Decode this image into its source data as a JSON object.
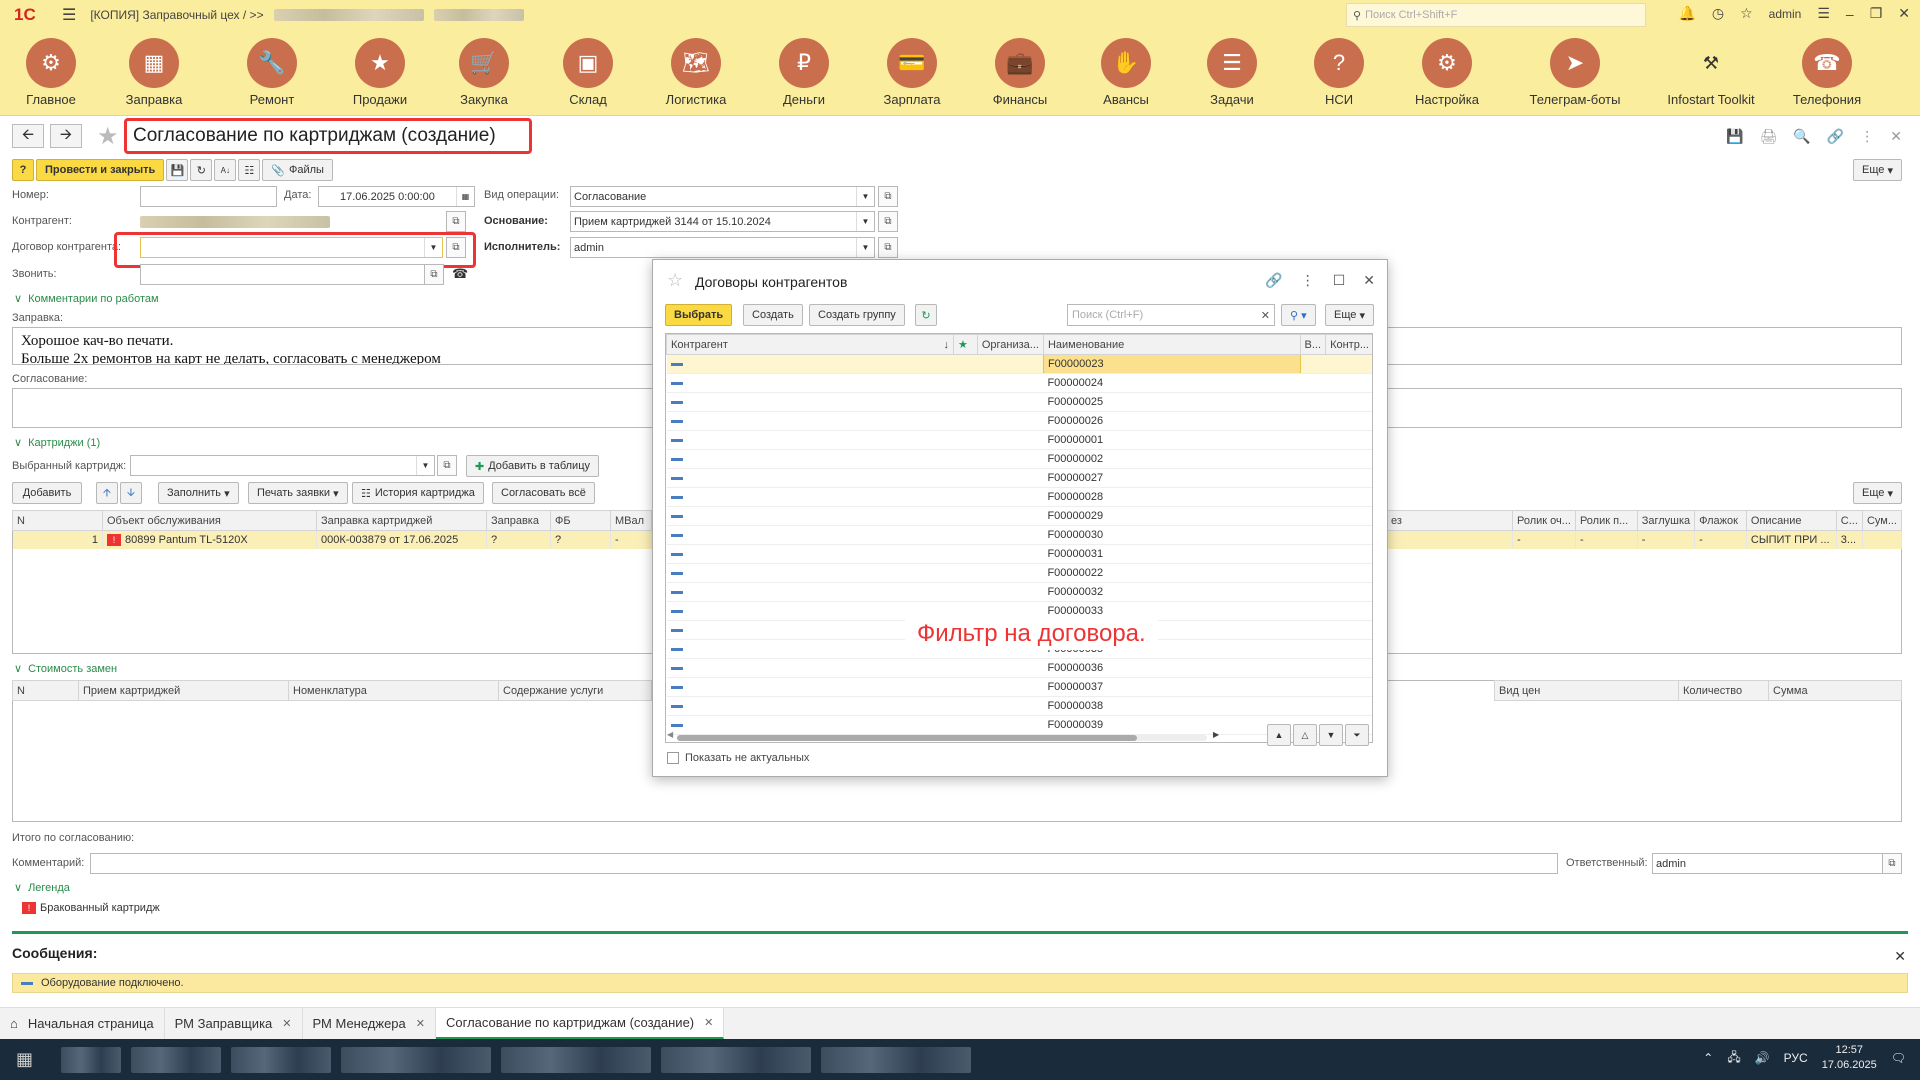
{
  "topbar": {
    "app_title": "[КОПИЯ] Заправочный цех / >>",
    "search_placeholder": "Поиск Ctrl+Shift+F",
    "user": "admin"
  },
  "sections": [
    {
      "label": "Главное",
      "icon": "gear-icon"
    },
    {
      "label": "Заправка",
      "icon": "cartridge-icon"
    },
    {
      "label": "Ремонт",
      "icon": "wrench-icon"
    },
    {
      "label": "Продажи",
      "icon": "sale-icon"
    },
    {
      "label": "Закупка",
      "icon": "cart-icon"
    },
    {
      "label": "Склад",
      "icon": "boxes-icon"
    },
    {
      "label": "Логистика",
      "icon": "map-icon"
    },
    {
      "label": "Деньги",
      "icon": "money-bag-icon"
    },
    {
      "label": "Зарплата",
      "icon": "wallet-icon"
    },
    {
      "label": "Финансы",
      "icon": "briefcase-icon"
    },
    {
      "label": "Авансы",
      "icon": "hand-money-icon"
    },
    {
      "label": "Задачи",
      "icon": "task-list-icon"
    },
    {
      "label": "НСИ",
      "icon": "question-doc-icon"
    },
    {
      "label": "Настройка",
      "icon": "settings-icon"
    },
    {
      "label": "Телеграм-боты",
      "icon": "telegram-icon"
    },
    {
      "label": "Infostart Toolkit",
      "icon": "tools-icon"
    },
    {
      "label": "Телефония",
      "icon": "phone-icon"
    }
  ],
  "document": {
    "title": "Согласование по картриджам (создание)",
    "post_close": "Провести и закрыть",
    "files": "Файлы",
    "more": "Еще",
    "labels": {
      "number": "Номер:",
      "date": "Дата:",
      "operation": "Вид операции:",
      "counterparty": "Контрагент:",
      "basis": "Основание:",
      "contract": "Договор контрагента:",
      "executor": "Исполнитель:",
      "call": "Звонить:"
    },
    "values": {
      "date": "17.06.2025  0:00:00",
      "operation": "Согласование",
      "basis": "Прием картриджей 3144 от 15.10.2024",
      "executor": "admin"
    },
    "comments_group": "Комментарии по работам",
    "refill_label": "Заправка:",
    "refill_text_1": "Хорошое кач-во печати.",
    "refill_text_2": "Больше 2х ремонтов на карт не делать, согласовать с менеджером",
    "approval_label": "Согласование:",
    "cartridges_group": "Картриджи (1)",
    "selected_cartridge": "Выбранный картридж:",
    "add_to_table": "Добавить в таблицу",
    "buttons": {
      "add": "Добавить",
      "fill": "Заполнить",
      "print": "Печать заявки",
      "history": "История картриджа",
      "approve_all": "Согласовать всё"
    },
    "cart_columns": [
      "N",
      "Объект обслуживания",
      "Заправка картриджей",
      "Заправка",
      "ФБ",
      "МВал"
    ],
    "cart_columns_right": [
      "Ролик оч...",
      "Ролик п...",
      "Заглушка",
      "Флажок",
      "Описание",
      "С...",
      "Сум..."
    ],
    "cart_columns_mid_tail": "ез",
    "cart_row": {
      "n": "1",
      "object": "80899 Pantum TL-5120X",
      "refill_doc": "000К-003879 от 17.06.2025",
      "refill": "?",
      "fb": "?",
      "mval": "-",
      "right": [
        "-",
        "-",
        "-",
        "-",
        "СЫПИТ ПРИ ...",
        "3..."
      ]
    },
    "cost_group": "Стоимость замен",
    "cost_columns": [
      "N",
      "Прием картриджей",
      "Номенклатура",
      "Содержание услуги"
    ],
    "cost_columns_right": [
      "Вид цен",
      "Количество",
      "Сумма"
    ],
    "total_label": "Итого по согласованию:",
    "comment_label": "Комментарий:",
    "responsible_label": "Ответственный:",
    "responsible": "admin",
    "legend_group": "Легенда",
    "legend_item": "Бракованный картридж"
  },
  "messages": {
    "title": "Сообщения:",
    "text": "Оборудование подключено."
  },
  "tabs": [
    {
      "label": "Начальная страница",
      "home": true
    },
    {
      "label": "РМ Заправщика"
    },
    {
      "label": "РМ Менеджера"
    },
    {
      "label": "Согласование по картриджам (создание)",
      "active": true
    }
  ],
  "taskbar": {
    "lang": "РУС",
    "time": "12:57",
    "date": "17.06.2025"
  },
  "dialog": {
    "title": "Договоры контрагентов",
    "select": "Выбрать",
    "create": "Создать",
    "create_group": "Создать группу",
    "search_placeholder": "Поиск (Ctrl+F)",
    "more": "Еще",
    "columns": [
      "Контрагент",
      "Организа...",
      "Наименование",
      "В...",
      "Контр..."
    ],
    "rows": [
      "F00000023",
      "F00000024",
      "F00000025",
      "F00000026",
      "F00000001",
      "F00000002",
      "F00000027",
      "F00000028",
      "F00000029",
      "F00000030",
      "F00000031",
      "F00000022",
      "F00000032",
      "F00000033",
      "F00000034",
      "F00000035",
      "F00000036",
      "F00000037",
      "F00000038",
      "F00000039"
    ],
    "overlay": "Фильтр на договора.",
    "show_inactive": "Показать не актуальных"
  },
  "colors": {
    "accent_yellow": "#fad942",
    "section_bg": "#fbed9e",
    "section_icon": "#c96f4d",
    "annotation_red": "#e33333",
    "group_green": "#2a8c4a"
  }
}
